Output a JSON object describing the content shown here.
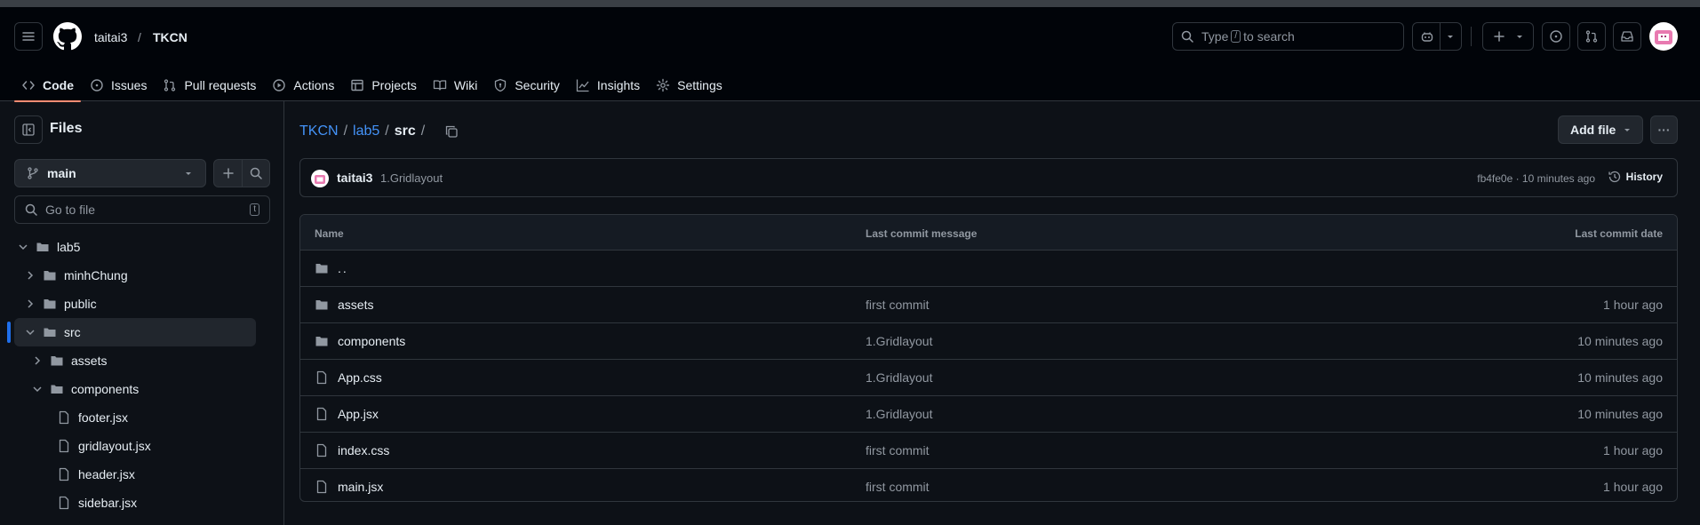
{
  "header": {
    "owner": "taitai3",
    "separator": "/",
    "repo": "TKCN",
    "search_prefix": "Type",
    "search_key": "/",
    "search_suffix": "to search"
  },
  "tabs": [
    {
      "label": "Code",
      "icon": "code-icon"
    },
    {
      "label": "Issues",
      "icon": "issue-icon"
    },
    {
      "label": "Pull requests",
      "icon": "pull-request-icon"
    },
    {
      "label": "Actions",
      "icon": "play-icon"
    },
    {
      "label": "Projects",
      "icon": "table-icon"
    },
    {
      "label": "Wiki",
      "icon": "book-icon"
    },
    {
      "label": "Security",
      "icon": "shield-icon"
    },
    {
      "label": "Insights",
      "icon": "graph-icon"
    },
    {
      "label": "Settings",
      "icon": "gear-icon"
    }
  ],
  "sidebar": {
    "title": "Files",
    "branch": "main",
    "go_to_file": "Go to file",
    "go_to_file_key": "t",
    "tree": [
      {
        "label": "lab5",
        "type": "folder",
        "expanded": true
      },
      {
        "label": "minhChung",
        "type": "folder",
        "expanded": false
      },
      {
        "label": "public",
        "type": "folder",
        "expanded": false
      },
      {
        "label": "src",
        "type": "folder",
        "expanded": true,
        "selected": true
      },
      {
        "label": "assets",
        "type": "folder",
        "expanded": false
      },
      {
        "label": "components",
        "type": "folder",
        "expanded": true
      },
      {
        "label": "footer.jsx",
        "type": "file"
      },
      {
        "label": "gridlayout.jsx",
        "type": "file"
      },
      {
        "label": "header.jsx",
        "type": "file"
      },
      {
        "label": "sidebar.jsx",
        "type": "file"
      }
    ]
  },
  "breadcrumb": {
    "root": "TKCN",
    "sep1": "/",
    "folder": "lab5",
    "sep2": "/",
    "current": "src",
    "sep3": "/"
  },
  "actions": {
    "add_file": "Add file",
    "more": "···"
  },
  "commit": {
    "author": "taitai3",
    "message": "1.Gridlayout",
    "hash_time": "fb4fe0e · 10 minutes ago",
    "history": "History"
  },
  "table": {
    "headers": {
      "name": "Name",
      "message": "Last commit message",
      "date": "Last commit date"
    },
    "parent": "..",
    "rows": [
      {
        "name": "assets",
        "type": "folder",
        "message": "first commit",
        "date": "1 hour ago"
      },
      {
        "name": "components",
        "type": "folder",
        "message": "1.Gridlayout",
        "date": "10 minutes ago"
      },
      {
        "name": "App.css",
        "type": "file",
        "message": "1.Gridlayout",
        "date": "10 minutes ago"
      },
      {
        "name": "App.jsx",
        "type": "file",
        "message": "1.Gridlayout",
        "date": "10 minutes ago"
      },
      {
        "name": "index.css",
        "type": "file",
        "message": "first commit",
        "date": "1 hour ago"
      },
      {
        "name": "main.jsx",
        "type": "file",
        "message": "first commit",
        "date": "1 hour ago"
      }
    ]
  },
  "colors": {
    "bg": "#0d1117",
    "header_bg": "#010409",
    "border": "#30363d",
    "link": "#4493f8",
    "text": "#e6edf3",
    "muted": "#9198a1",
    "tab_underline": "#fd8c73",
    "selected_bar": "#1f6feb"
  }
}
